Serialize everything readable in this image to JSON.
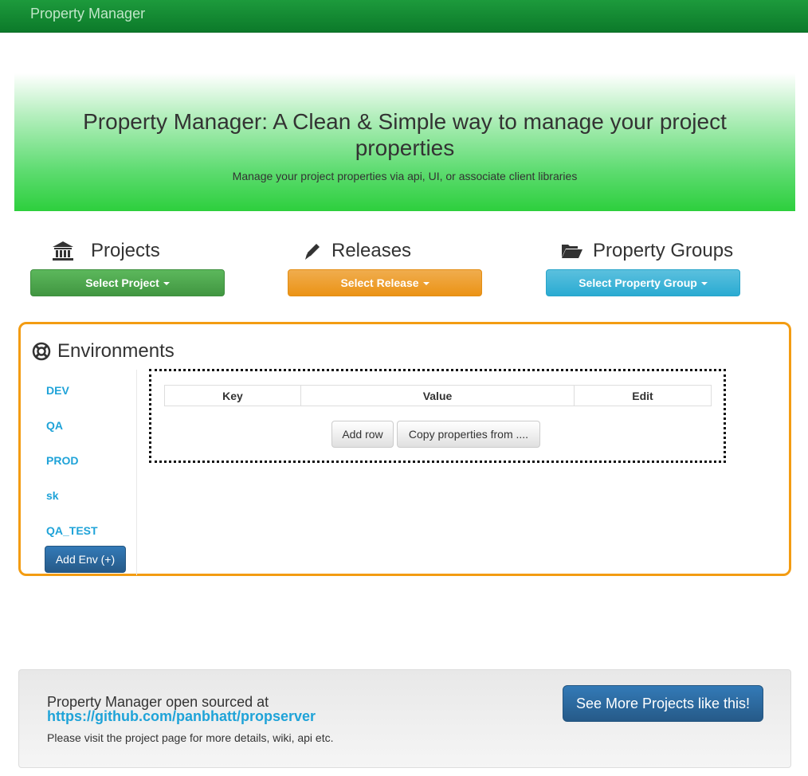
{
  "navbar": {
    "brand": "Property Manager"
  },
  "jumbotron": {
    "title": "Property Manager: A Clean & Simple way to manage your project properties",
    "subtitle": "Manage your project properties via api, UI, or associate client libraries"
  },
  "columns": {
    "projects": {
      "heading": "Projects",
      "icon": "bank-icon",
      "button": "Select Project",
      "color": "#5cb85c"
    },
    "releases": {
      "heading": "Releases",
      "icon": "pencil-icon",
      "button": "Select Release",
      "color": "#f0ad4e"
    },
    "groups": {
      "heading": "Property Groups",
      "icon": "folder-open-icon",
      "button": "Select Property Group",
      "color": "#5bc0de"
    }
  },
  "environments": {
    "title": "Environments",
    "icon": "lifebuoy-icon",
    "items": [
      "DEV",
      "QA",
      "PROD",
      "sk",
      "QA_TEST"
    ],
    "add_button": "Add Env (+)",
    "border_color": "#f39c12"
  },
  "table": {
    "columns": [
      "Key",
      "Value",
      "Edit"
    ],
    "add_row": "Add row",
    "copy": "Copy properties from ...."
  },
  "footer": {
    "line1": "Property Manager open sourced at",
    "link": "https://github.com/panbhatt/propserver",
    "line2": "Please visit the project page for more details, wiki, api etc.",
    "button": "See More Projects like this!"
  }
}
